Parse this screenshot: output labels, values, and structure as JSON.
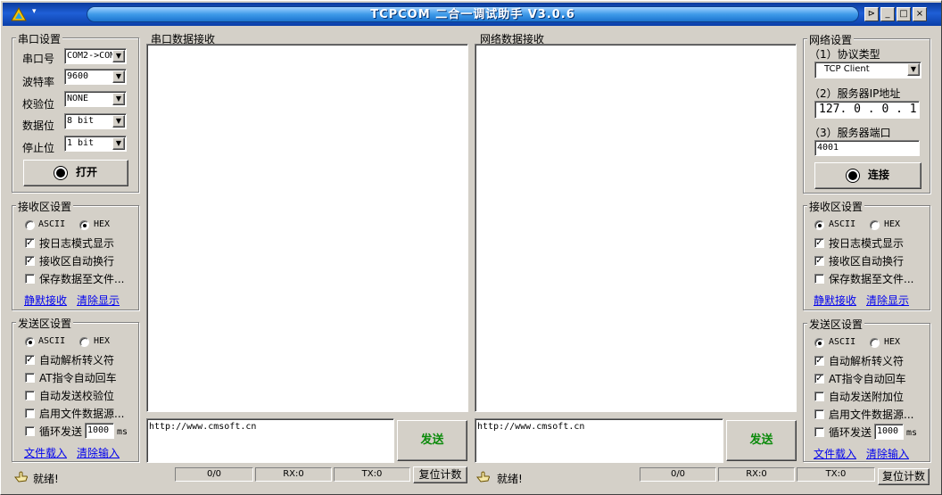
{
  "titlebar": {
    "title": "TCPCOM 二合一调试助手  V3.0.6",
    "menu_glyph": "▾",
    "buttons": {
      "pin": "⊳",
      "minimize": "_",
      "maximize": "□",
      "close": "×"
    }
  },
  "serial_settings": {
    "legend": "串口设置",
    "port_label": "串口号",
    "port_value": "COM2->COM",
    "baud_label": "波特率",
    "baud_value": "9600",
    "parity_label": "校验位",
    "parity_value": "NONE",
    "databits_label": "数据位",
    "databits_value": "8 bit",
    "stopbits_label": "停止位",
    "stopbits_value": "1 bit",
    "open_button": "打开"
  },
  "left_recv": {
    "legend": "接收区设置",
    "ascii": "ASCII",
    "hex": "HEX",
    "log_mode": "按日志模式显示",
    "auto_wrap": "接收区自动换行",
    "save_file": "保存数据至文件...",
    "silent_link": "静默接收",
    "clear_link": "清除显示"
  },
  "left_send": {
    "legend": "发送区设置",
    "ascii": "ASCII",
    "hex": "HEX",
    "auto_escape": "自动解析转义符",
    "at_cr": "AT指令自动回车",
    "auto_check": "自动发送校验位",
    "file_source": "启用文件数据源...",
    "loop_send": "循环发送",
    "loop_ms": "1000",
    "ms": "ms",
    "load_link": "文件载入",
    "clear_link": "清除输入"
  },
  "serial_recv": {
    "title": "串口数据接收"
  },
  "net_recv": {
    "title": "网络数据接收"
  },
  "serial_send": {
    "input": "http://www.cmsoft.cn",
    "send_button": "发送"
  },
  "net_send": {
    "input": "http://www.cmsoft.cn",
    "send_button": "发送"
  },
  "net_settings": {
    "legend": "网络设置",
    "proto_label": "（1）协议类型",
    "proto_value": "TCP Client",
    "ip_label": "（2）服务器IP地址",
    "ip_value": "127. 0 . 0 . 1",
    "port_label": "（3）服务器端口",
    "port_value": "4001",
    "connect_button": "连接"
  },
  "right_recv": {
    "legend": "接收区设置",
    "ascii": "ASCII",
    "hex": "HEX",
    "log_mode": "按日志模式显示",
    "auto_wrap": "接收区自动换行",
    "save_file": "保存数据至文件...",
    "silent_link": "静默接收",
    "clear_link": "清除显示"
  },
  "right_send": {
    "legend": "发送区设置",
    "ascii": "ASCII",
    "hex": "HEX",
    "auto_escape": "自动解析转义符",
    "at_cr": "AT指令自动回车",
    "auto_check": "自动发送附加位",
    "file_source": "启用文件数据源...",
    "loop_send": "循环发送",
    "loop_ms": "1000",
    "ms": "ms",
    "load_link": "文件载入",
    "clear_link": "清除输入"
  },
  "status_left": {
    "ready": "就绪!",
    "count": "0/0",
    "rx": "RX:0",
    "tx": "TX:0",
    "reset": "复位计数"
  },
  "status_right": {
    "ready": "就绪!",
    "count": "0/0",
    "rx": "RX:0",
    "tx": "TX:0",
    "reset": "复位计数"
  }
}
